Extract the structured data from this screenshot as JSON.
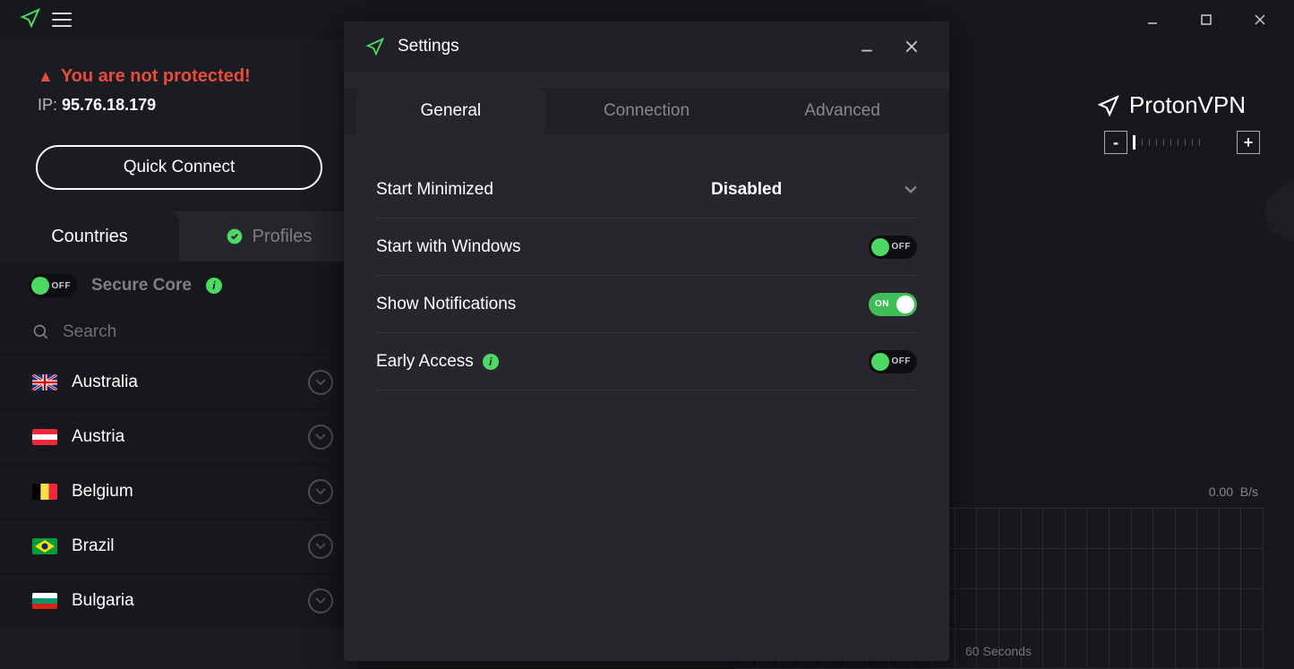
{
  "app": {
    "brand": "ProtonVPN"
  },
  "status": {
    "warning_text": "You are not protected!",
    "ip_label": "IP: ",
    "ip_value": "95.76.18.179"
  },
  "quick_connect_label": "Quick Connect",
  "sidebar_tabs": {
    "countries": "Countries",
    "profiles": "Profiles"
  },
  "secure_core": {
    "label": "Secure Core",
    "state": "OFF"
  },
  "search": {
    "placeholder": "Search"
  },
  "countries": [
    {
      "name": "Australia",
      "flag": "au"
    },
    {
      "name": "Austria",
      "flag": "at"
    },
    {
      "name": "Belgium",
      "flag": "be"
    },
    {
      "name": "Brazil",
      "flag": "br"
    },
    {
      "name": "Bulgaria",
      "flag": "bg"
    }
  ],
  "speed": {
    "value": "0.00",
    "unit": "B/s"
  },
  "chart_xlabel": "60 Seconds",
  "settings_modal": {
    "title": "Settings",
    "tabs": {
      "general": "General",
      "connection": "Connection",
      "advanced": "Advanced"
    },
    "rows": {
      "start_minimized": {
        "label": "Start Minimized",
        "value": "Disabled"
      },
      "start_windows": {
        "label": "Start with Windows",
        "state": "OFF"
      },
      "show_notifications": {
        "label": "Show Notifications",
        "state": "ON"
      },
      "early_access": {
        "label": "Early Access",
        "state": "OFF"
      }
    }
  }
}
